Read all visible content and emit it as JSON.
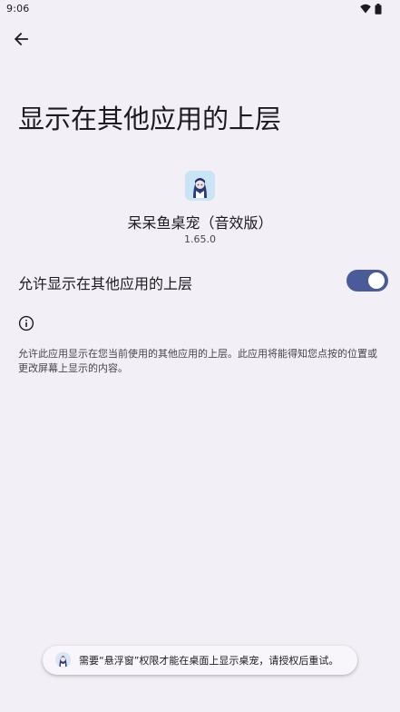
{
  "status_bar": {
    "time": "9:06",
    "icons": [
      "wifi-icon",
      "battery-icon"
    ]
  },
  "header": {
    "back_icon": "arrow-back-icon",
    "title": "显示在其他应用的上层"
  },
  "app": {
    "name": "呆呆鱼桌宠（音效版）",
    "version": "1.65.0",
    "icon": "app-avatar-icon"
  },
  "setting": {
    "label": "允许显示在其他应用的上层",
    "enabled": true,
    "accent_color": "#4a5b9a"
  },
  "info": {
    "icon": "info-icon",
    "text": "允许此应用显示在您当前使用的其他应用的上层。此应用将能得知您点按的位置或更改屏幕上显示的内容。"
  },
  "toast": {
    "icon": "app-avatar-icon",
    "text": "需要“悬浮窗”权限才能在桌面上显示桌宠，请授权后重试。"
  }
}
